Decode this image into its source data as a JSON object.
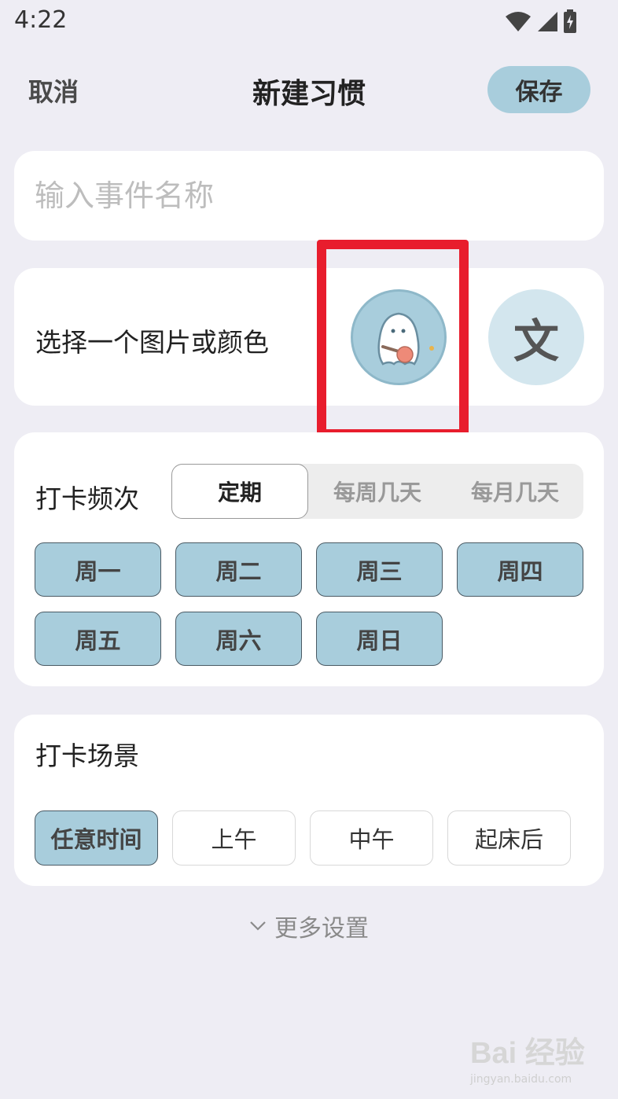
{
  "status_bar": {
    "time": "4:22",
    "icons": [
      "wifi-icon",
      "signal-icon",
      "battery-charging-icon"
    ]
  },
  "header": {
    "cancel_label": "取消",
    "title": "新建习惯",
    "save_label": "保存"
  },
  "name_field": {
    "placeholder": "输入事件名称",
    "value": ""
  },
  "image_picker": {
    "label": "选择一个图片或颜色",
    "text_avatar": "文",
    "image_avatar_icon": "ghost-pingpong-icon"
  },
  "frequency": {
    "label": "打卡频次",
    "modes": [
      "定期",
      "每周几天",
      "每月几天"
    ],
    "active_mode": "定期",
    "days": [
      "周一",
      "周二",
      "周三",
      "周四",
      "周五",
      "周六",
      "周日"
    ],
    "selected_days": [
      "周一",
      "周二",
      "周三",
      "周四",
      "周五",
      "周六",
      "周日"
    ]
  },
  "scene": {
    "label": "打卡场景",
    "options": [
      "任意时间",
      "上午",
      "中午",
      "起床后"
    ],
    "selected": "任意时间"
  },
  "more_settings": {
    "label": "更多设置",
    "icon": "chevron-down-icon"
  },
  "watermark": {
    "main": "Bai 经验",
    "sub": "jingyan.baidu.com"
  },
  "colors": {
    "accent": "#a8cddc",
    "background": "#eeedf4",
    "highlight": "#e81d2d"
  }
}
